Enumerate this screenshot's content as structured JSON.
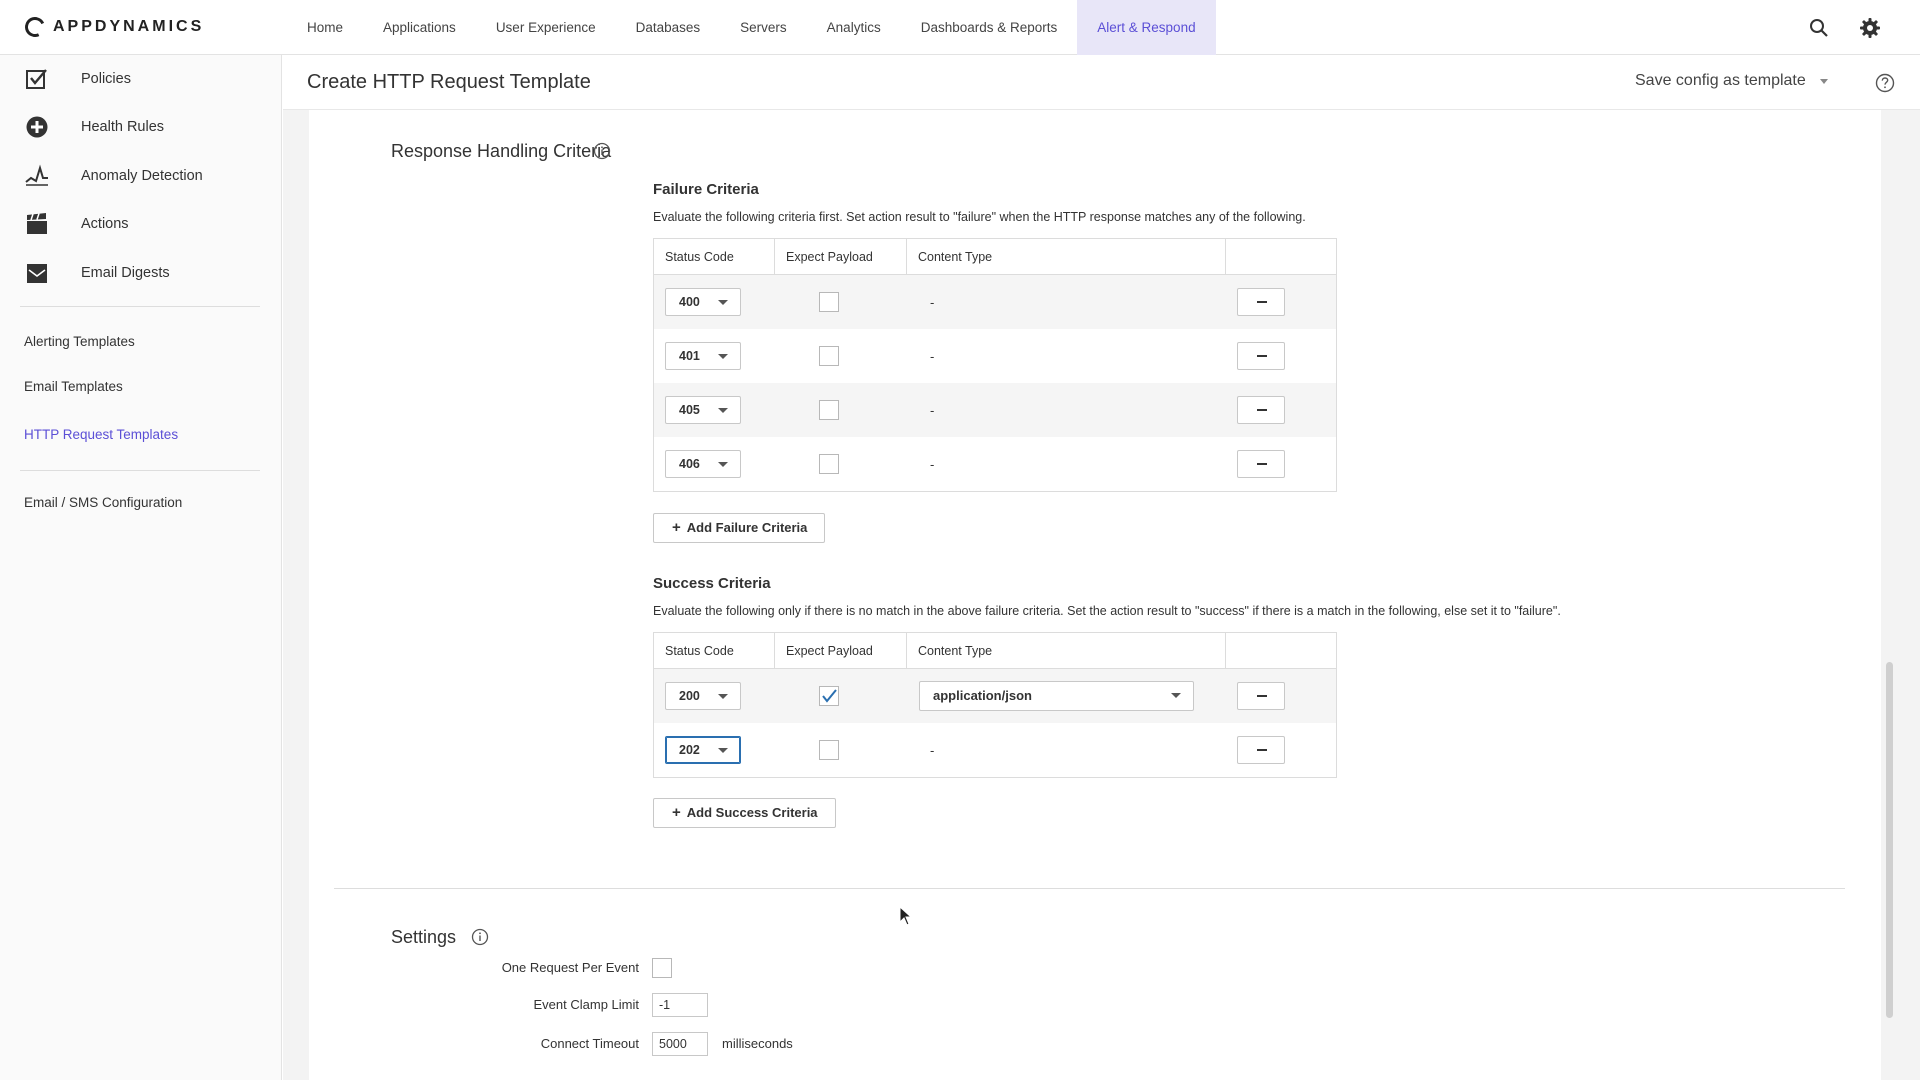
{
  "brand": {
    "logo_text": "APPDYNAMICS"
  },
  "nav": {
    "items": [
      "Home",
      "Applications",
      "User Experience",
      "Databases",
      "Servers",
      "Analytics",
      "Dashboards & Reports",
      "Alert & Respond"
    ],
    "active": "Alert & Respond",
    "accent_color": "#5b4fd6"
  },
  "sidebar": {
    "items": [
      {
        "label": "Policies",
        "icon": "checkbox-icon"
      },
      {
        "label": "Health Rules",
        "icon": "plus-circle-icon"
      },
      {
        "label": "Anomaly Detection",
        "icon": "anomaly-icon"
      },
      {
        "label": "Actions",
        "icon": "clapper-icon"
      },
      {
        "label": "Email Digests",
        "icon": "envelope-icon"
      }
    ],
    "links": [
      "Alerting Templates",
      "Email Templates",
      "HTTP Request Templates",
      "Email / SMS Configuration"
    ],
    "active_link": "HTTP Request Templates"
  },
  "header": {
    "title": "Create HTTP Request Template",
    "save_config": "Save config as template"
  },
  "response_handling": {
    "title": "Response Handling Criteria",
    "failure": {
      "title": "Failure Criteria",
      "description": "Evaluate the following criteria first. Set action result to \"failure\" when the HTTP response matches any of the following.",
      "columns": [
        "Status Code",
        "Expect Payload",
        "Content Type",
        ""
      ],
      "rows": [
        {
          "status": "400",
          "expect_payload": false,
          "content_type": "-"
        },
        {
          "status": "401",
          "expect_payload": false,
          "content_type": "-"
        },
        {
          "status": "405",
          "expect_payload": false,
          "content_type": "-"
        },
        {
          "status": "406",
          "expect_payload": false,
          "content_type": "-"
        }
      ],
      "add_label": "Add Failure Criteria"
    },
    "success": {
      "title": "Success Criteria",
      "description": "Evaluate the following only if there is no match in the above failure criteria. Set the action result to \"success\" if there is a match in the following, else set it to \"failure\".",
      "columns": [
        "Status Code",
        "Expect Payload",
        "Content Type",
        ""
      ],
      "rows": [
        {
          "status": "200",
          "expect_payload": true,
          "content_type": "application/json"
        },
        {
          "status": "202",
          "expect_payload": false,
          "content_type": "-"
        }
      ],
      "add_label": "Add Success Criteria"
    }
  },
  "settings": {
    "title": "Settings",
    "one_request_label": "One Request Per Event",
    "one_request_checked": false,
    "clamp_label": "Event Clamp Limit",
    "clamp_value": "-1",
    "connect_label": "Connect Timeout",
    "connect_value": "5000",
    "connect_unit": "milliseconds"
  }
}
